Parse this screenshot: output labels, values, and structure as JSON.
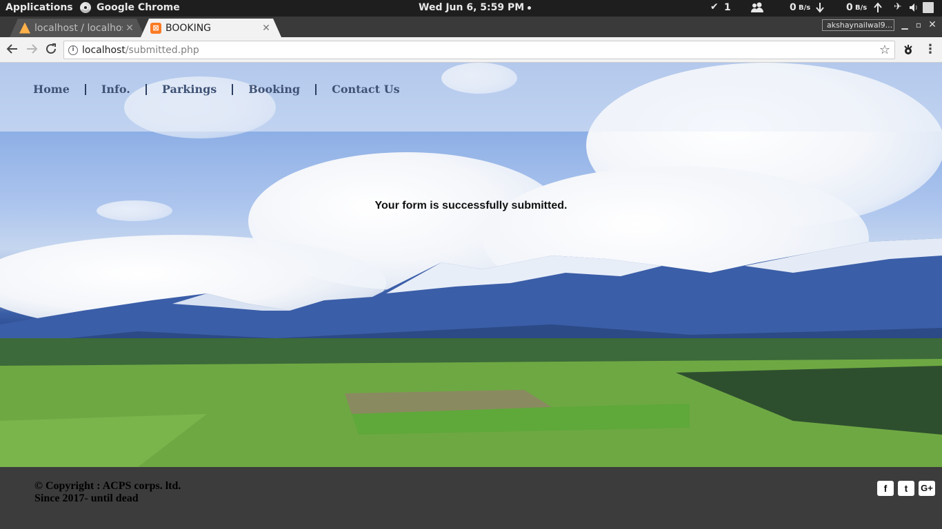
{
  "system_bar": {
    "applications": "Applications",
    "active_app": "Google Chrome",
    "clock": "Wed Jun  6,  5:59 PM",
    "updates_count": "1",
    "net_down_value": "0",
    "net_down_unit": "B/s",
    "net_up_value": "0",
    "net_up_unit": "B/s"
  },
  "browser": {
    "tabs": [
      {
        "title": "localhost / localhost",
        "active": false
      },
      {
        "title": "BOOKING",
        "active": true
      }
    ],
    "profile": "akshaynailwal9...",
    "address": {
      "host": "localhost",
      "path": "/submitted.php"
    }
  },
  "page": {
    "nav": [
      "Home",
      "Info.",
      "Parkings",
      "Booking",
      "Contact Us"
    ],
    "message": "Your form is successfully submitted.",
    "footer": {
      "copyright": "© Copyright : ACPS corps. ltd.",
      "since": "Since 2017- until dead",
      "social": [
        "f",
        "t",
        "G+"
      ]
    }
  },
  "colors": {
    "topbar": "#1e1e1e",
    "nav_text": "#3f5276",
    "footer_bg": "#3c3c3c"
  }
}
